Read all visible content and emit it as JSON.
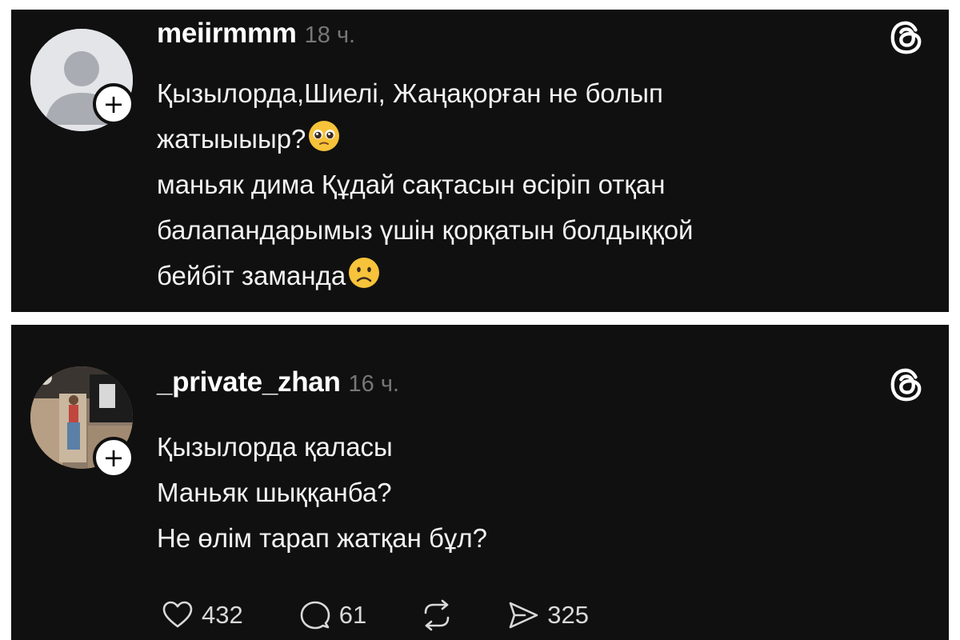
{
  "posts": [
    {
      "username": "meiirmmm",
      "time": "18 ч.",
      "lines": [
        "Қызылорда,Шиелі, Жаңақорған не болып",
        "жатыыыыр?",
        "маньяк дима Құдай сақтасын өсіріп отқан",
        "балапандарымыз үшін қорқатын болдыққой",
        "бейбіт заманда"
      ],
      "emojis": [
        "pleading-face-emoji",
        "slightly-frowning-face-emoji"
      ]
    },
    {
      "username": "_private_zhan",
      "time": "16 ч.",
      "lines": [
        "Қызылорда қаласы",
        "Маньяк шыққанба?",
        "Не өлім тарап жатқан бұл?"
      ],
      "actions": {
        "likes": "432",
        "replies": "61",
        "shares": "325"
      }
    }
  ],
  "icons": [
    "threads-logo-icon",
    "plus-icon",
    "heart-icon",
    "reply-icon",
    "repost-icon",
    "share-icon"
  ],
  "colors": {
    "background": "#101010",
    "text": "#f3f3f3",
    "muted": "#777777"
  }
}
